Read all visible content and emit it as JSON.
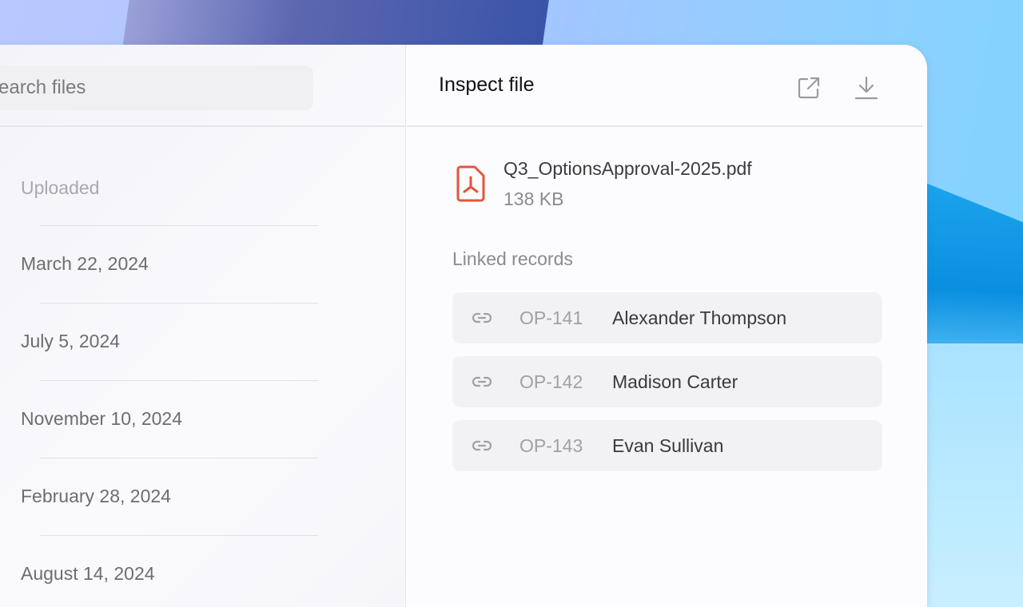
{
  "search": {
    "placeholder": "earch files"
  },
  "file_list": {
    "header": "Uploaded",
    "dates": [
      "March 22, 2024",
      "July 5, 2024",
      "November 10, 2024",
      "February 28, 2024",
      "August 14, 2024"
    ]
  },
  "inspector": {
    "title": "Inspect file",
    "actions": {
      "open_external": "external-link-icon",
      "download": "download-icon"
    },
    "file": {
      "name": "Q3_OptionsApproval-2025.pdf",
      "size": "138 KB",
      "icon": "pdf-icon",
      "icon_color": "#e5553a"
    },
    "linked_label": "Linked records",
    "records": [
      {
        "id": "OP-141",
        "name": "Alexander Thompson"
      },
      {
        "id": "OP-142",
        "name": "Madison Carter"
      },
      {
        "id": "OP-143",
        "name": "Evan Sullivan"
      }
    ]
  }
}
